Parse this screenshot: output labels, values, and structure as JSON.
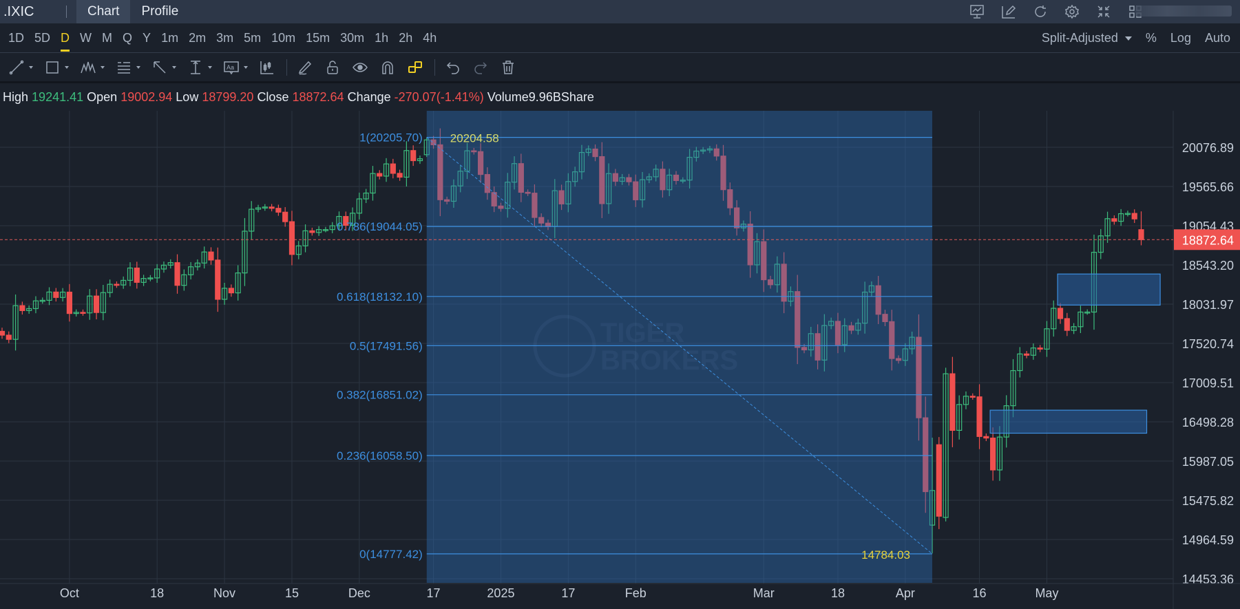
{
  "header": {
    "symbol": ".IXIC",
    "tabs": [
      {
        "label": "Chart",
        "active": true
      },
      {
        "label": "Profile",
        "active": false
      }
    ],
    "icons": [
      "chart-monitor-icon",
      "edit-icon",
      "refresh-icon",
      "gear-icon",
      "compress-icon",
      "grid-icon"
    ]
  },
  "timeframes": {
    "items": [
      "1D",
      "5D",
      "D",
      "W",
      "M",
      "Q",
      "Y",
      "1m",
      "2m",
      "3m",
      "5m",
      "10m",
      "15m",
      "30m",
      "1h",
      "2h",
      "4h"
    ],
    "active": "D",
    "adjust_label": "Split-Adjusted",
    "percent_label": "%",
    "log_label": "Log",
    "auto_label": "Auto"
  },
  "toolbar": {
    "tools": [
      "trend-line",
      "rectangle",
      "pattern",
      "fibonacci",
      "arrow",
      "measure",
      "text",
      "indicator",
      "pencil",
      "lock",
      "eye",
      "magnet",
      "link",
      "undo",
      "redo",
      "trash"
    ]
  },
  "ohlc": {
    "high_label": "High",
    "high": "19241.41",
    "open_label": "Open",
    "open": "19002.94",
    "low_label": "Low",
    "low": "18799.20",
    "close_label": "Close",
    "close": "18872.64",
    "change_label": "Change",
    "change": "-270.07(-1.41%)",
    "volume_label": "Volume",
    "volume": "9.96BShare"
  },
  "colors": {
    "up": "#3dbd7d",
    "down": "#f0504f",
    "fib": "#3d8fe0",
    "accent": "#f2d024"
  },
  "watermark": {
    "line1": "TIGER",
    "line2": "BROKERS"
  },
  "chart_data": {
    "type": "candlestick",
    "title": ".IXIC",
    "ylim": [
      14453.36,
      20300
    ],
    "yticks": [
      "20076.89",
      "19565.66",
      "19054.43",
      "18543.20",
      "18031.97",
      "17520.74",
      "17009.51",
      "16498.28",
      "15987.05",
      "15475.82",
      "14964.59",
      "14453.36"
    ],
    "xticks": [
      {
        "label": "Oct",
        "index": 10
      },
      {
        "label": "18",
        "index": 23
      },
      {
        "label": "Nov",
        "index": 33
      },
      {
        "label": "15",
        "index": 43
      },
      {
        "label": "Dec",
        "index": 53
      },
      {
        "label": "17",
        "index": 64
      },
      {
        "label": "2025",
        "index": 74
      },
      {
        "label": "17",
        "index": 84
      },
      {
        "label": "Feb",
        "index": 94
      },
      {
        "label": "Mar",
        "index": 113
      },
      {
        "label": "18",
        "index": 124
      },
      {
        "label": "Apr",
        "index": 134
      },
      {
        "label": "16",
        "index": 145
      },
      {
        "label": "May",
        "index": 155
      }
    ],
    "last_price": "18872.64",
    "close": [
      17628,
      17573,
      18013,
      17948,
      17974,
      18075,
      18082,
      18190,
      18119,
      18189,
      17910,
      17925,
      17918,
      18138,
      17923,
      18183,
      18291,
      18282,
      18342,
      18503,
      18316,
      18367,
      18374,
      18490,
      18540,
      18573,
      18277,
      18415,
      18519,
      18568,
      18712,
      18607,
      18095,
      18239,
      18179,
      18439,
      18983,
      19269,
      19287,
      19298,
      19281,
      19231,
      19107,
      18680,
      18792,
      18988,
      18966,
      19004,
      19004,
      19054,
      19175,
      19060,
      19218,
      19404,
      19480,
      19735,
      19701,
      19860,
      19737,
      19687,
      20034,
      19902,
      19927,
      20173,
      20109,
      19393,
      19373,
      19573,
      19765,
      20031,
      20020,
      19722,
      19487,
      19311,
      19280,
      19622,
      19864,
      19490,
      19479,
      19162,
      19088,
      19044,
      19511,
      19338,
      19630,
      19757,
      20009,
      20054,
      19955,
      19342,
      19734,
      19633,
      19681,
      19627,
      19392,
      19654,
      19692,
      19791,
      19523,
      19714,
      19643,
      19649,
      19946,
      20027,
      20041,
      20056,
      19962,
      19524,
      19287,
      19026,
      19075,
      18544,
      18847,
      18350,
      18285,
      18553,
      18070,
      18196,
      17468,
      17436,
      17648,
      17303,
      17754,
      17808,
      17504,
      17751,
      17692,
      17784,
      18189,
      18272,
      17900,
      17804,
      17323,
      17299,
      17450,
      17601,
      16551,
      15588,
      15603,
      15268,
      17125,
      16387,
      16724,
      16832,
      16824,
      16307,
      16287,
      15871,
      16300,
      16708,
      17166,
      17383,
      17366,
      17461,
      17446,
      17711,
      17978,
      17844,
      17690,
      17738,
      17929,
      17929,
      18708,
      18922,
      19146,
      19112,
      19211,
      19215,
      19143,
      18872.64
    ],
    "ohlc_overrides": {
      "63": [
        19980,
        20204.58,
        19950,
        20173
      ],
      "138": [
        15152,
        16292,
        14784.03,
        15603
      ],
      "139": [
        16200,
        16300,
        15100,
        15268
      ],
      "140": [
        15252,
        17204,
        15200,
        17125
      ],
      "169": [
        19002.94,
        19241.41,
        18799.2,
        18872.64
      ]
    },
    "fibonacci": {
      "start_index": 63,
      "end_index": 138,
      "high_label": "20204.58",
      "low_label": "14784.03",
      "levels": [
        {
          "label": "1(20205.70)",
          "value": 20205.7
        },
        {
          "label": "0.786(19044.05)",
          "value": 19044.05
        },
        {
          "label": "0.618(18132.10)",
          "value": 18132.1
        },
        {
          "label": "0.5(17491.56)",
          "value": 17491.56
        },
        {
          "label": "0.382(16851.02)",
          "value": 16851.02
        },
        {
          "label": "0.236(16058.50)",
          "value": 16058.5
        },
        {
          "label": "0(14777.42)",
          "value": 14777.42
        }
      ]
    },
    "zones": [
      {
        "start_index": 147,
        "end_index": 169,
        "top": 16650,
        "bottom": 16350
      },
      {
        "start_index": 157,
        "end_index": 171,
        "top": 18425,
        "bottom": 18020
      }
    ]
  }
}
